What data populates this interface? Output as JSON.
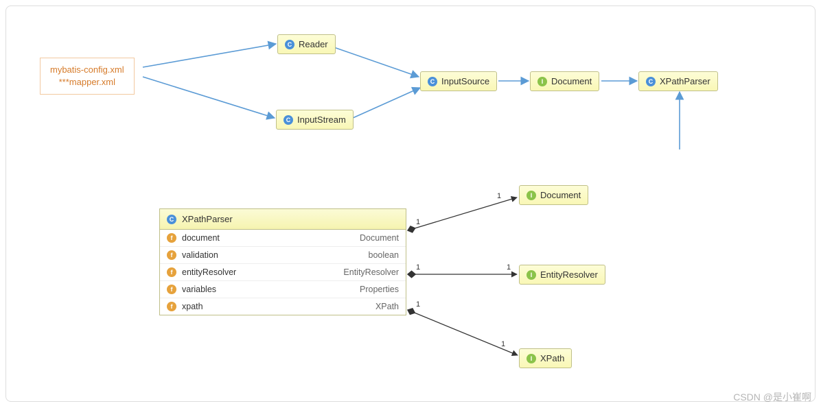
{
  "xmlBox": {
    "line1": "mybatis-config.xml",
    "line2": "***mapper.xml"
  },
  "nodes": {
    "reader": {
      "iconType": "C",
      "label": "Reader"
    },
    "inputStream": {
      "iconType": "C",
      "label": "InputStream"
    },
    "inputSource": {
      "iconType": "C",
      "label": "InputSource"
    },
    "document": {
      "iconType": "I",
      "label": "Document"
    },
    "xpathParser": {
      "iconType": "C",
      "label": "XPathParser"
    },
    "document2": {
      "iconType": "I",
      "label": "Document"
    },
    "entityResolver": {
      "iconType": "I",
      "label": "EntityResolver"
    },
    "xpath": {
      "iconType": "I",
      "label": "XPath"
    }
  },
  "classBox": {
    "header": {
      "iconType": "C",
      "name": "XPathParser"
    },
    "fields": [
      {
        "name": "document",
        "type": "Document"
      },
      {
        "name": "validation",
        "type": "boolean"
      },
      {
        "name": "entityResolver",
        "type": "EntityResolver"
      },
      {
        "name": "variables",
        "type": "Properties"
      },
      {
        "name": "xpath",
        "type": "XPath"
      }
    ]
  },
  "multiplicities": {
    "m1": "1",
    "m2": "1",
    "m3": "1",
    "m4": "1",
    "m5": "1",
    "m6": "1"
  },
  "watermark": "CSDN @是小崔啊"
}
